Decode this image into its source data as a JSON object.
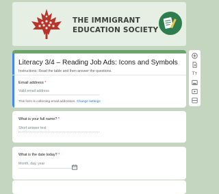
{
  "banner": {
    "title_line1": "THE IMMIGRANT",
    "title_line2": "EDUCATION SOCIETY",
    "logo_icon": "maple-leaf-mosaic-icon",
    "badge_icon": "document-pen-icon",
    "colors": {
      "background": "#e5efe3",
      "leaf": "#b8352c",
      "badge": "#2e7d4f"
    }
  },
  "form": {
    "title": "Literacy 3/4 – Reading Job Ads: Icons and Symbols",
    "instructions": "Instructions: Read the table and then answer the questions.",
    "email": {
      "label": "Email address",
      "required_mark": "*",
      "placeholder": "Valid email address",
      "note": "This form is collecting email addresses.",
      "note_link": "Change settings"
    }
  },
  "questions": [
    {
      "label": "What is your full name?",
      "required_mark": "*",
      "placeholder": "Short answer text"
    },
    {
      "label": "What is the date today?",
      "required_mark": "*",
      "placeholder": "Month, day, year"
    }
  ],
  "toolbar": {
    "items": [
      {
        "name": "add-question",
        "icon": "add-circle-icon"
      },
      {
        "name": "import-questions",
        "icon": "import-icon"
      },
      {
        "name": "add-title",
        "icon": "title-icon",
        "text": "Tт"
      },
      {
        "name": "add-image",
        "icon": "image-icon"
      },
      {
        "name": "add-video",
        "icon": "video-icon"
      },
      {
        "name": "add-section",
        "icon": "section-icon"
      }
    ]
  },
  "colors": {
    "page_background": "#c4d6c0",
    "theme_bar": "#6aa56b",
    "focus_accent": "#4285f4",
    "required": "#d93025",
    "link": "#1a73e8"
  }
}
